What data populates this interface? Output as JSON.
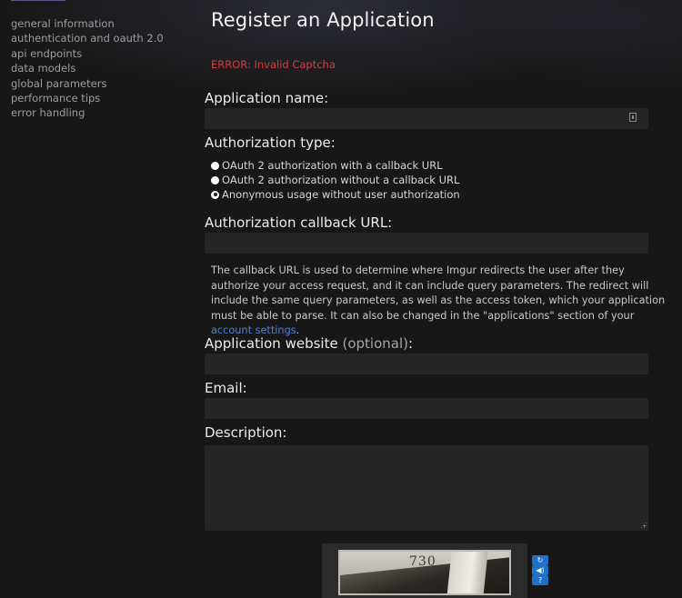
{
  "sidebar": {
    "items": [
      {
        "label": "general information"
      },
      {
        "label": "authentication and oauth 2.0"
      },
      {
        "label": "api endpoints"
      },
      {
        "label": "data models"
      },
      {
        "label": "global parameters"
      },
      {
        "label": "performance tips"
      },
      {
        "label": "error handling"
      }
    ]
  },
  "page": {
    "title": "Register an Application",
    "error": "ERROR: Invalid Captcha"
  },
  "form": {
    "app_name": {
      "label": "Application name:",
      "value": ""
    },
    "auth_type": {
      "label": "Authorization type:",
      "options": [
        {
          "label": "OAuth 2 authorization with a callback URL",
          "checked": false
        },
        {
          "label": "OAuth 2 authorization without a callback URL",
          "checked": false
        },
        {
          "label": "Anonymous usage without user authorization",
          "checked": true
        }
      ]
    },
    "callback_url": {
      "label": "Authorization callback URL:",
      "value": "",
      "help_text": "The callback URL is used to determine where Imgur redirects the user after they authorize your access request, and it can include query parameters. The redirect will include the same query parameters, as well as the access token, which your application must be able to parse. It can also be changed in the \"applications\" section of your",
      "help_link": "account settings",
      "help_end": "."
    },
    "website": {
      "label": "Application website",
      "optional": "(optional)",
      "colon": ":",
      "value": ""
    },
    "email": {
      "label": "Email:",
      "value": ""
    },
    "description": {
      "label": "Description:",
      "value": ""
    }
  },
  "captcha": {
    "image_text": "730",
    "buttons": [
      {
        "icon": "refresh-icon",
        "glyph": "↻"
      },
      {
        "icon": "audio-icon",
        "glyph": "◀)"
      },
      {
        "icon": "help-icon",
        "glyph": "?"
      }
    ]
  },
  "colors": {
    "background": "#171717",
    "error": "#d23d3d",
    "link": "#4f7fd8",
    "input_bg": "#252525",
    "captcha_button": "#1f72c8"
  }
}
